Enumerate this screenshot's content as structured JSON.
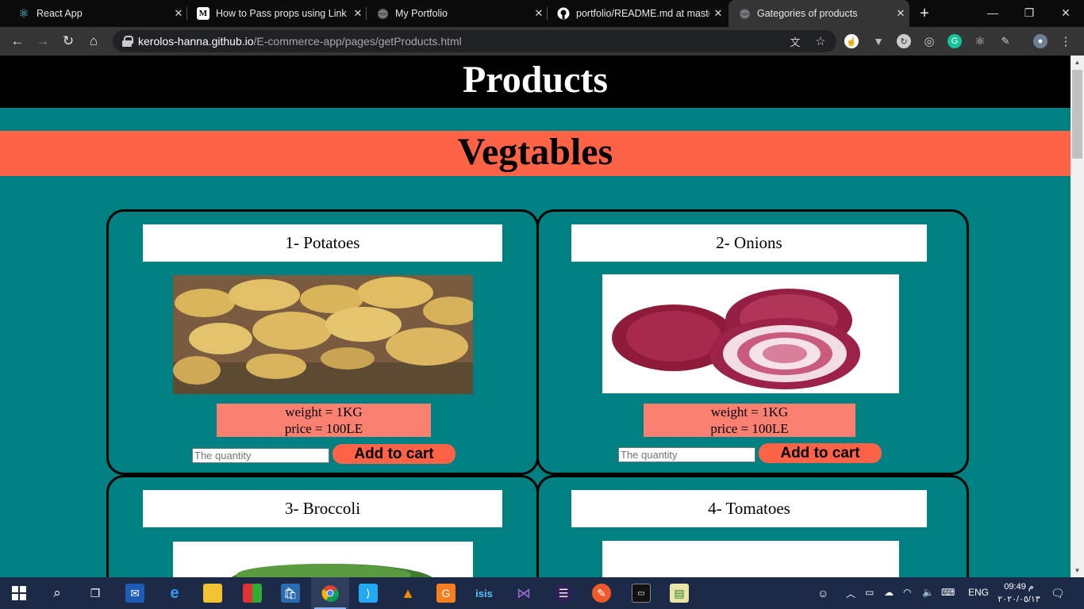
{
  "browser": {
    "tabs": [
      {
        "title": "React App",
        "icon": "react-icon"
      },
      {
        "title": "How to Pass props using Link a",
        "icon": "medium-icon"
      },
      {
        "title": "My Portfolio",
        "icon": "globe-icon"
      },
      {
        "title": "portfolio/README.md at maste",
        "icon": "github-icon"
      },
      {
        "title": "Gategories of products",
        "icon": "globe-icon"
      }
    ],
    "active_tab": 4,
    "url_host": "kerolos-hanna.github.io",
    "url_path": "/E-commerce-app/pages/getProducts.html"
  },
  "page": {
    "header": "Products",
    "category": "Vegtables",
    "products": [
      {
        "title": "1- Potatoes",
        "weight": "weight = 1KG",
        "price": "price = 100LE",
        "qty_placeholder": "The quantity",
        "button": "Add to cart"
      },
      {
        "title": "2- Onions",
        "weight": "weight = 1KG",
        "price": "price = 100LE",
        "qty_placeholder": "The quantity",
        "button": "Add to cart"
      },
      {
        "title": "3- Broccoli"
      },
      {
        "title": "4- Tomatoes"
      }
    ]
  },
  "taskbar": {
    "lang": "ENG",
    "time": "09:49 م",
    "date": "٢٠٢٠/٠٥/١٣"
  },
  "colors": {
    "page_bg": "#008080",
    "header_bg": "#000000",
    "category_bg": "#ff6347",
    "info_bg": "#fa8072",
    "button_bg": "#ff6347"
  }
}
